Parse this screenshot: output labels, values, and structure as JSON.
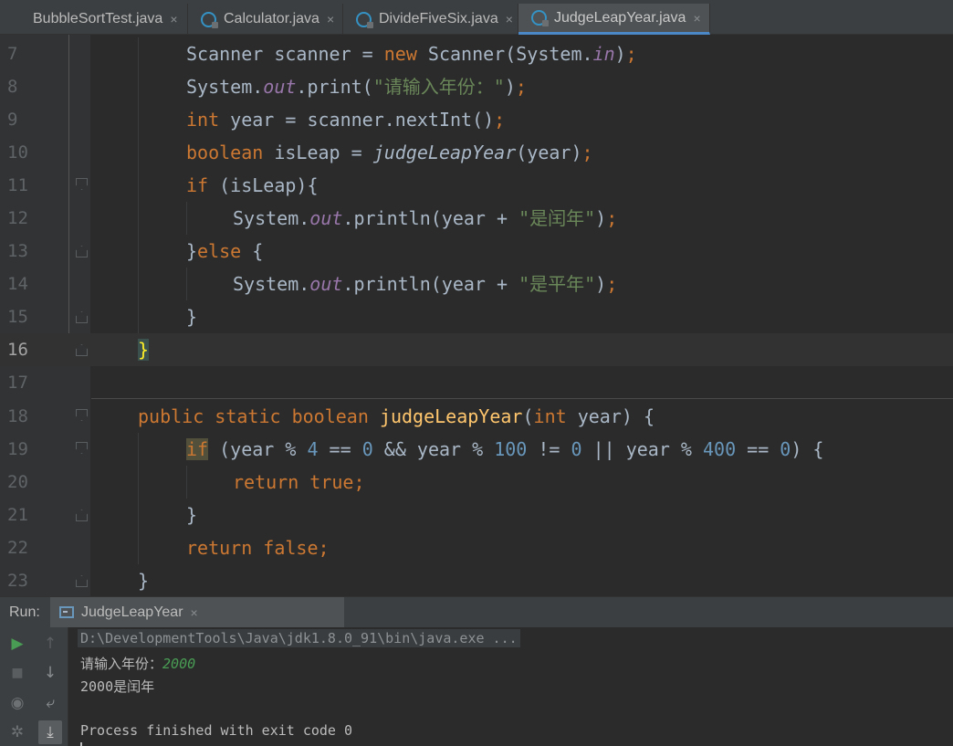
{
  "tabs": [
    {
      "label": "BubbleSortTest.java",
      "active": false,
      "close": "×"
    },
    {
      "label": "Calculator.java",
      "active": false,
      "close": "×"
    },
    {
      "label": "DivideFiveSix.java",
      "active": false,
      "close": "×"
    },
    {
      "label": "JudgeLeapYear.java",
      "active": true,
      "close": "×"
    }
  ],
  "editor": {
    "current_line": "16",
    "lines": [
      {
        "num": "7"
      },
      {
        "num": "8"
      },
      {
        "num": "9"
      },
      {
        "num": "10"
      },
      {
        "num": "11"
      },
      {
        "num": "12"
      },
      {
        "num": "13"
      },
      {
        "num": "14"
      },
      {
        "num": "15"
      },
      {
        "num": "16"
      },
      {
        "num": "17"
      },
      {
        "num": "18"
      },
      {
        "num": "19"
      },
      {
        "num": "20"
      },
      {
        "num": "21"
      },
      {
        "num": "22"
      },
      {
        "num": "23"
      }
    ],
    "code": {
      "l7": {
        "a": "Scanner scanner = ",
        "kw": "new",
        "b": " Scanner(System.",
        "fld": "in",
        "c": ")",
        "semi": ";"
      },
      "l8": {
        "a": "System.",
        "fld": "out",
        "b": ".print(",
        "str": "\"请输入年份：\"",
        "c": ")",
        "semi": ";"
      },
      "l9": {
        "kw": "int",
        "a": " year = scanner.nextInt()",
        "semi": ";"
      },
      "l10": {
        "kw": "boolean",
        "a": " isLeap = ",
        "call": "judgeLeapYear",
        "b": "(year)",
        "semi": ";"
      },
      "l11": {
        "kw": "if",
        "a": " (isLeap){"
      },
      "l12": {
        "a": "System.",
        "fld": "out",
        "b": ".println(year + ",
        "str": "\"是闰年\"",
        "c": ")",
        "semi": ";"
      },
      "l13": {
        "a": "}",
        "kw": "else",
        "b": " {"
      },
      "l14": {
        "a": "System.",
        "fld": "out",
        "b": ".println(year + ",
        "str": "\"是平年\"",
        "c": ")",
        "semi": ";"
      },
      "l15": {
        "a": "}"
      },
      "l16": {
        "a": "}"
      },
      "l18": {
        "kw1": "public",
        "sp1": " ",
        "kw2": "static",
        "sp2": " ",
        "kw3": "boolean",
        "sp3": " ",
        "fn": "judgeLeapYear",
        "a": "(",
        "kw4": "int",
        "b": " year) {"
      },
      "l19": {
        "kw": "if",
        "a": " (year % ",
        "n1": "4",
        "b": " == ",
        "n2": "0",
        "c": " && year % ",
        "n3": "100",
        "d": " != ",
        "n4": "0",
        "e": " || year % ",
        "n5": "400",
        "f": " == ",
        "n6": "0",
        "g": ") {"
      },
      "l20": {
        "kw1": "return",
        "sp": " ",
        "kw2": "true",
        "semi": ";"
      },
      "l21": {
        "a": "}"
      },
      "l22": {
        "kw1": "return",
        "sp": " ",
        "kw2": "false",
        "semi": ";"
      },
      "l23": {
        "a": "}"
      }
    }
  },
  "run": {
    "label": "Run:",
    "tab_label": "JudgeLeapYear",
    "tab_close": "×",
    "console": {
      "command": "D:\\DevelopmentTools\\Java\\jdk1.8.0_91\\bin\\java.exe ...",
      "prompt": "请输入年份：",
      "user_input": "2000",
      "result": "2000是闰年",
      "exit": "Process finished with exit code 0"
    }
  },
  "toolbar_icons": {
    "rerun": "▶",
    "up": "↑",
    "stop": "■",
    "down": "↓",
    "camera": "◉",
    "wrap": "⤶",
    "settings": "✲",
    "scroll_end": "⤓"
  },
  "colors": {
    "keyword": "#cc7832",
    "function": "#ffc66d",
    "number": "#6897bb",
    "string": "#6a8759",
    "field": "#9876aa",
    "text": "#a9b7c6",
    "accent": "#4a88c7",
    "run_green": "#499c54"
  }
}
